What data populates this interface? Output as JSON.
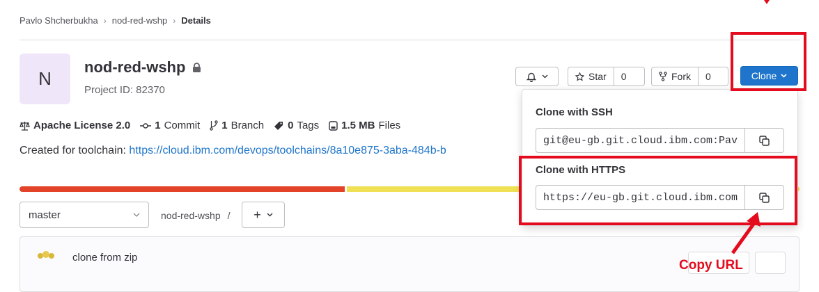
{
  "breadcrumb": {
    "user": "Pavlo Shcherbukha",
    "separator": "›",
    "project": "nod-red-wshp",
    "current": "Details"
  },
  "project": {
    "avatar_letter": "N",
    "name": "nod-red-wshp",
    "id_text": "Project ID: 82370"
  },
  "actions": {
    "notification_icon": "bell-icon",
    "star_label": "Star",
    "star_count": "0",
    "fork_label": "Fork",
    "fork_count": "0",
    "clone_label": "Clone"
  },
  "stats": {
    "license": "Apache License 2.0",
    "commits_count": "1",
    "commits_label": "Commit",
    "branches_count": "1",
    "branches_label": "Branch",
    "tags_count": "0",
    "tags_label": "Tags",
    "files_size": "1.5 MB",
    "files_label": "Files"
  },
  "description": {
    "prefix": "Created for toolchain: ",
    "link": "https://cloud.ibm.com/devops/toolchains/8a10e875-3aba-484b-b"
  },
  "language_bar": [
    {
      "color": "#e24329",
      "share": 0.42
    },
    {
      "color": "#efe055",
      "share": 0.58
    }
  ],
  "repo": {
    "branch": "master",
    "path": "nod-red-wshp",
    "path_separator": "/",
    "add_label": "+"
  },
  "last_commit": {
    "message": "clone from zip"
  },
  "clone_dropdown": {
    "ssh_label": "Clone with SSH",
    "ssh_value": "git@eu-gb.git.cloud.ibm.com:Pav",
    "https_label": "Clone with HTTPS",
    "https_value": "https://eu-gb.git.cloud.ibm.com"
  },
  "annotation": {
    "text": "Copy URL",
    "color": "#e30b1d"
  }
}
